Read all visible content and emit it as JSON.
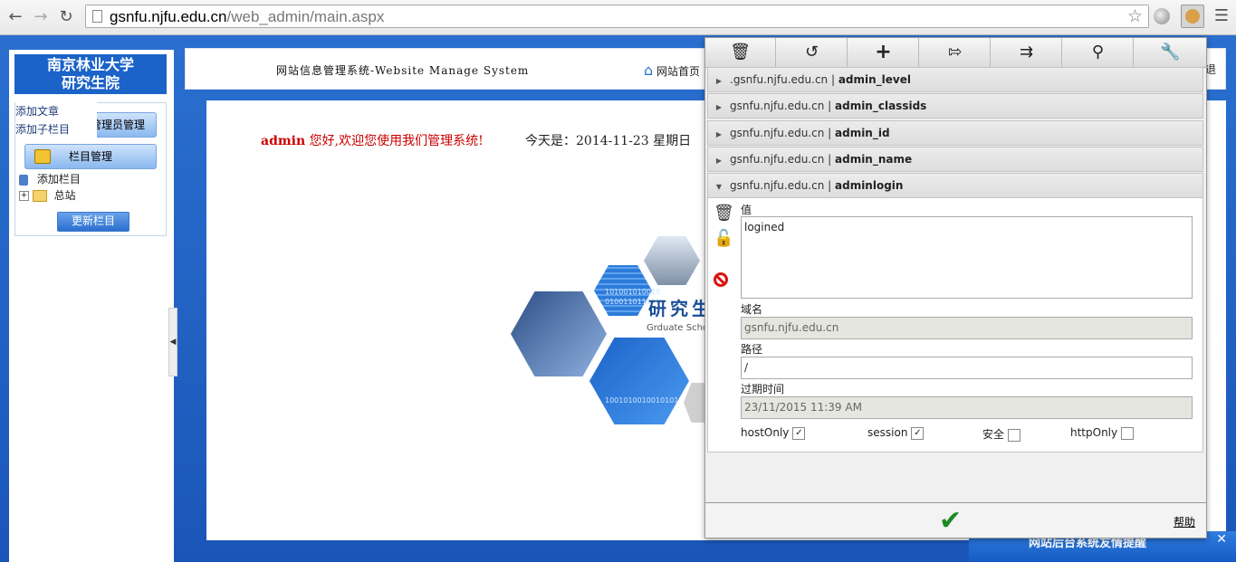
{
  "browser": {
    "url_host": "gsnfu.njfu.edu.cn",
    "url_path": "/web_admin/main.aspx"
  },
  "left": {
    "logo_line1": "南京林业大学",
    "logo_line2": "研究生院",
    "popup_items": [
      "添加文章",
      "添加子栏目"
    ],
    "admin_btn": "管理员管理",
    "column_btn": "栏目管理",
    "tree_add": "添加栏目",
    "tree_root": "总站",
    "refresh_btn": "更新栏目"
  },
  "header": {
    "title": "网站信息管理系统-Website Manage System",
    "home": "网站首页",
    "logout_fragment": "退"
  },
  "content": {
    "user": "admin",
    "welcome": "您好,欢迎您使用我们管理系统!",
    "today": "今天是：2014-11-23 星期日",
    "banner_title": "研究生",
    "banner_sub": "Grduate Scho",
    "bin1": "101001010010",
    "bin2": "010011011011",
    "bin3": "1001010010010101"
  },
  "bottom_notice": "网站后台系统友情提醒",
  "cookie_editor": {
    "cookies": [
      {
        "domain": ".gsnfu.njfu.edu.cn",
        "name": "admin_level"
      },
      {
        "domain": "gsnfu.njfu.edu.cn",
        "name": "admin_classids"
      },
      {
        "domain": "gsnfu.njfu.edu.cn",
        "name": "admin_id"
      },
      {
        "domain": "gsnfu.njfu.edu.cn",
        "name": "admin_name"
      },
      {
        "domain": "gsnfu.njfu.edu.cn",
        "name": "adminlogin"
      }
    ],
    "value_label": "值",
    "value": "logined",
    "domain_label": "域名",
    "domain": "gsnfu.njfu.edu.cn",
    "path_label": "路径",
    "path": "/",
    "expires_label": "过期时间",
    "expires": "23/11/2015 11:39 AM",
    "host_only_label": "hostOnly",
    "session_label": "session",
    "secure_label": "安全",
    "http_only_label": "httpOnly",
    "help": "帮助",
    "host_only": true,
    "session": true,
    "secure": false,
    "http_only": false
  }
}
